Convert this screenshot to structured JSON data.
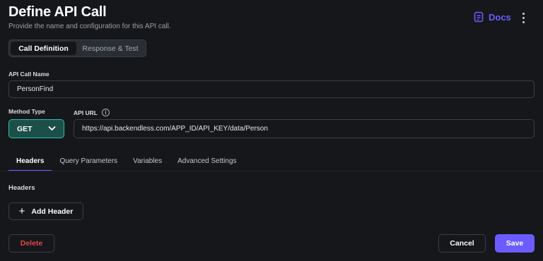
{
  "header": {
    "title": "Define API Call",
    "subtitle": "Provide the name and configuration for this API call.",
    "docs_label": "Docs",
    "accent_color": "#6c5cff"
  },
  "segmented": {
    "items": [
      {
        "label": "Call Definition",
        "active": true
      },
      {
        "label": "Response & Test",
        "active": false
      }
    ]
  },
  "form": {
    "api_call_name_label": "API Call Name",
    "api_call_name_value": "PersonFind",
    "method_type_label": "Method Type",
    "method_type_value": "GET",
    "api_url_label": "API URL",
    "api_url_value": "https://api.backendless.com/APP_ID/API_KEY/data/Person"
  },
  "tabs": [
    {
      "label": "Headers",
      "active": true
    },
    {
      "label": "Query Parameters",
      "active": false
    },
    {
      "label": "Variables",
      "active": false
    },
    {
      "label": "Advanced Settings",
      "active": false
    }
  ],
  "headers_section": {
    "title": "Headers",
    "add_button_label": "Add Header"
  },
  "footer": {
    "delete_label": "Delete",
    "cancel_label": "Cancel",
    "save_label": "Save",
    "delete_color": "#e0463f"
  },
  "icons": [
    "docs-icon",
    "more-vert-icon",
    "info-icon",
    "chevron-down-icon",
    "plus-icon"
  ]
}
